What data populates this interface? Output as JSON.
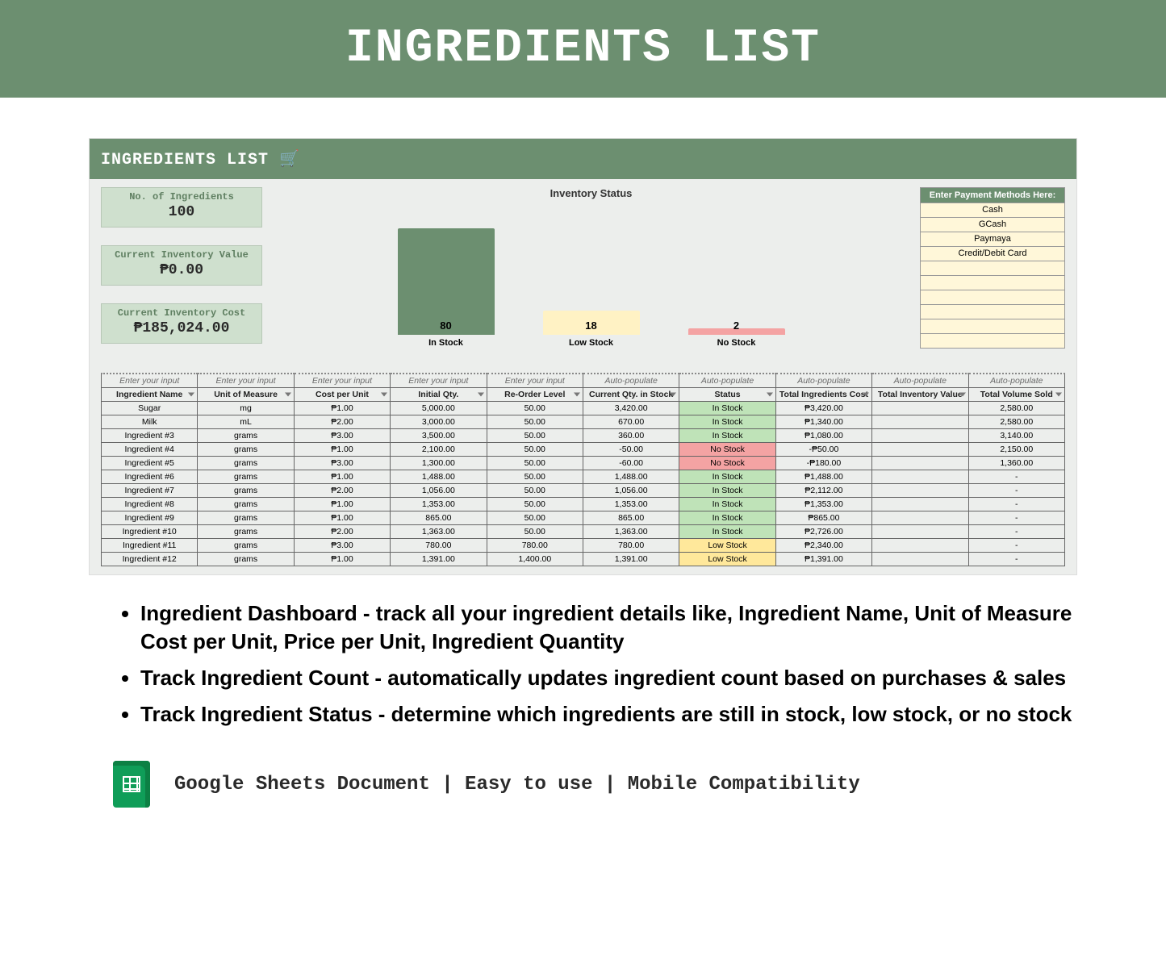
{
  "header": {
    "title": "INGREDIENTS LIST"
  },
  "dashboard": {
    "title": "INGREDIENTS LIST 🛒",
    "kpis": [
      {
        "label": "No. of Ingredients",
        "value": "100"
      },
      {
        "label": "Current Inventory Value",
        "value": "₱0.00"
      },
      {
        "label": "Current Inventory Cost",
        "value": "₱185,024.00"
      }
    ],
    "payment_methods": {
      "header": "Enter Payment Methods Here:",
      "rows": [
        "Cash",
        "GCash",
        "Paymaya",
        "Credit/Debit Card",
        "",
        "",
        "",
        "",
        "",
        ""
      ]
    }
  },
  "chart_data": {
    "type": "bar",
    "title": "Inventory Status",
    "categories": [
      "In Stock",
      "Low Stock",
      "No Stock"
    ],
    "values": [
      80,
      18,
      2
    ],
    "colors": [
      "#6c8f70",
      "#fff2c4",
      "#f4a3a3"
    ],
    "ylim": [
      0,
      100
    ]
  },
  "table": {
    "hints": [
      "Enter your input",
      "Enter your input",
      "Enter your input",
      "Enter your input",
      "Enter your input",
      "Auto-populate",
      "Auto-populate",
      "Auto-populate",
      "Auto-populate",
      "Auto-populate"
    ],
    "headers": [
      "Ingredient Name",
      "Unit of Measure",
      "Cost per Unit",
      "Initial Qty.",
      "Re-Order Level",
      "Current Qty. in Stock",
      "Status",
      "Total Ingredients Cost",
      "Total Inventory Value",
      "Total Volume Sold"
    ],
    "rows": [
      [
        "Sugar",
        "mg",
        "₱1.00",
        "5,000.00",
        "50.00",
        "3,420.00",
        "In Stock",
        "₱3,420.00",
        "",
        "2,580.00"
      ],
      [
        "Milk",
        "mL",
        "₱2.00",
        "3,000.00",
        "50.00",
        "670.00",
        "In Stock",
        "₱1,340.00",
        "",
        "2,580.00"
      ],
      [
        "Ingredient #3",
        "grams",
        "₱3.00",
        "3,500.00",
        "50.00",
        "360.00",
        "In Stock",
        "₱1,080.00",
        "",
        "3,140.00"
      ],
      [
        "Ingredient #4",
        "grams",
        "₱1.00",
        "2,100.00",
        "50.00",
        "-50.00",
        "No Stock",
        "-₱50.00",
        "",
        "2,150.00"
      ],
      [
        "Ingredient #5",
        "grams",
        "₱3.00",
        "1,300.00",
        "50.00",
        "-60.00",
        "No Stock",
        "-₱180.00",
        "",
        "1,360.00"
      ],
      [
        "Ingredient #6",
        "grams",
        "₱1.00",
        "1,488.00",
        "50.00",
        "1,488.00",
        "In Stock",
        "₱1,488.00",
        "",
        "-"
      ],
      [
        "Ingredient #7",
        "grams",
        "₱2.00",
        "1,056.00",
        "50.00",
        "1,056.00",
        "In Stock",
        "₱2,112.00",
        "",
        "-"
      ],
      [
        "Ingredient #8",
        "grams",
        "₱1.00",
        "1,353.00",
        "50.00",
        "1,353.00",
        "In Stock",
        "₱1,353.00",
        "",
        "-"
      ],
      [
        "Ingredient #9",
        "grams",
        "₱1.00",
        "865.00",
        "50.00",
        "865.00",
        "In Stock",
        "₱865.00",
        "",
        "-"
      ],
      [
        "Ingredient #10",
        "grams",
        "₱2.00",
        "1,363.00",
        "50.00",
        "1,363.00",
        "In Stock",
        "₱2,726.00",
        "",
        "-"
      ],
      [
        "Ingredient #11",
        "grams",
        "₱3.00",
        "780.00",
        "780.00",
        "780.00",
        "Low Stock",
        "₱2,340.00",
        "",
        "-"
      ],
      [
        "Ingredient #12",
        "grams",
        "₱1.00",
        "1,391.00",
        "1,400.00",
        "1,391.00",
        "Low Stock",
        "₱1,391.00",
        "",
        "-"
      ]
    ]
  },
  "bullets": [
    "Ingredient Dashboard - track all your ingredient details like, Ingredient Name, Unit of Measure Cost per Unit, Price per Unit, Ingredient Quantity",
    "Track Ingredient Count - automatically updates ingredient count based on purchases & sales",
    "Track Ingredient Status - determine which ingredients are still in stock, low stock, or no stock"
  ],
  "footer": {
    "text": "Google Sheets Document  |  Easy to use  |  Mobile Compatibility"
  }
}
